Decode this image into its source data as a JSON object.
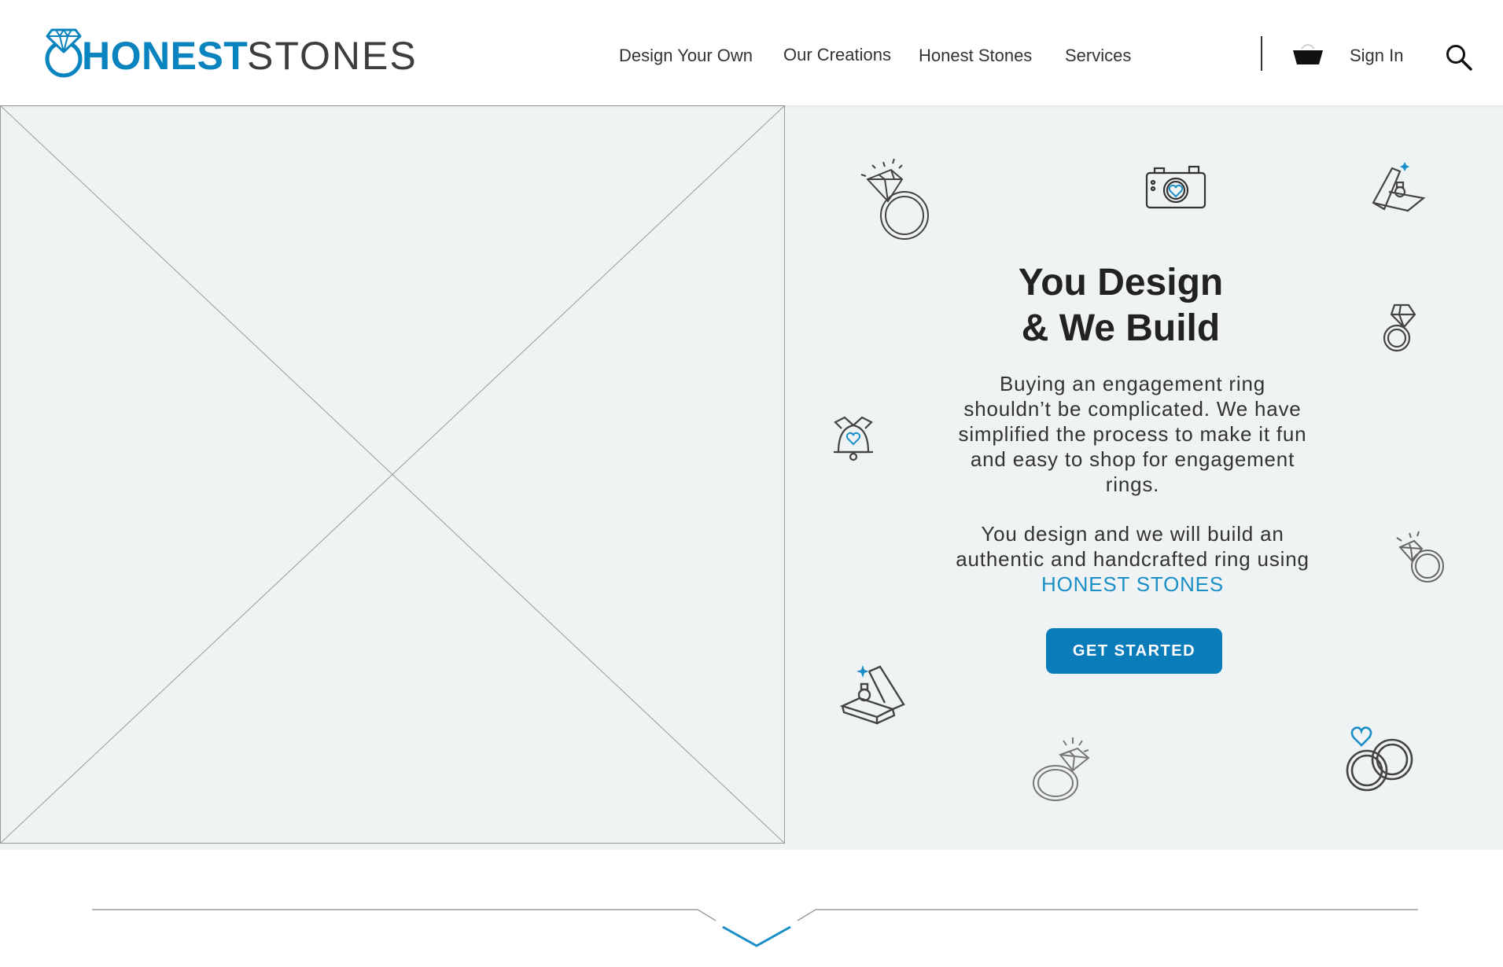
{
  "header": {
    "logo": {
      "part1": "HONEST",
      "part2": "STONES"
    },
    "nav": [
      {
        "label": "Design Your Own"
      },
      {
        "label": "Our Creations"
      },
      {
        "label": "Honest Stones"
      },
      {
        "label": "Services"
      }
    ],
    "cart_icon": "shopping-basket-icon",
    "signin_label": "Sign In",
    "search_icon": "magnifier-icon"
  },
  "hero": {
    "image_placeholder": "image-placeholder",
    "headline_line1": "You Design",
    "headline_line2": "& We Build",
    "paragraph1": "Buying an engagement ring shouldn’t be complicated. We have simplified the process to make it fun and easy to shop for engagement rings.",
    "paragraph2_prefix": "You design and we will build an authentic and handcrafted ring using",
    "paragraph2_brand": "HONEST STONES",
    "cta_label": "GET STARTED"
  },
  "decorative_icons": [
    "diamond-ring-icon",
    "camera-heart-icon",
    "ring-box-icon",
    "small-ring-icon",
    "wedding-bell-icon",
    "sparkle-ring-icon",
    "ring-box-open-icon",
    "diamond-ring-icon-2",
    "wedding-rings-icon"
  ],
  "scroll_indicator": "chevron-down-icon",
  "colors": {
    "brand_blue": "#0a84bf",
    "cta_blue": "#0b7cba",
    "hero_bg": "#f0f3f4",
    "text_dark": "#222222"
  }
}
